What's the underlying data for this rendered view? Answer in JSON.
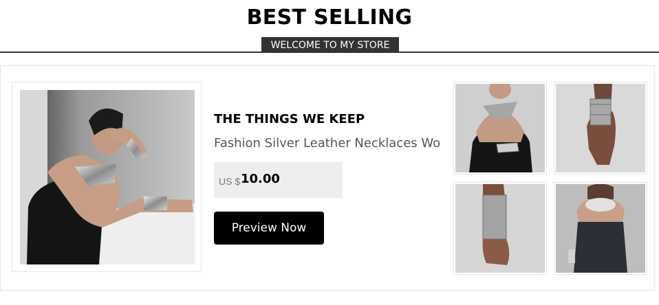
{
  "header": {
    "title": "BEST SELLING",
    "subtitle": "WELCOME TO MY STORE"
  },
  "product": {
    "name": "THE THINGS WE KEEP",
    "description": "Fashion Silver Leather Necklaces Women's Choker Necklace Geometric",
    "price_prefix": "US $",
    "price_value": "10.00",
    "button_label": "Preview Now"
  },
  "colors": {
    "title_bar": "#333333",
    "button": "#000000",
    "price_bg": "#eeeeee"
  }
}
